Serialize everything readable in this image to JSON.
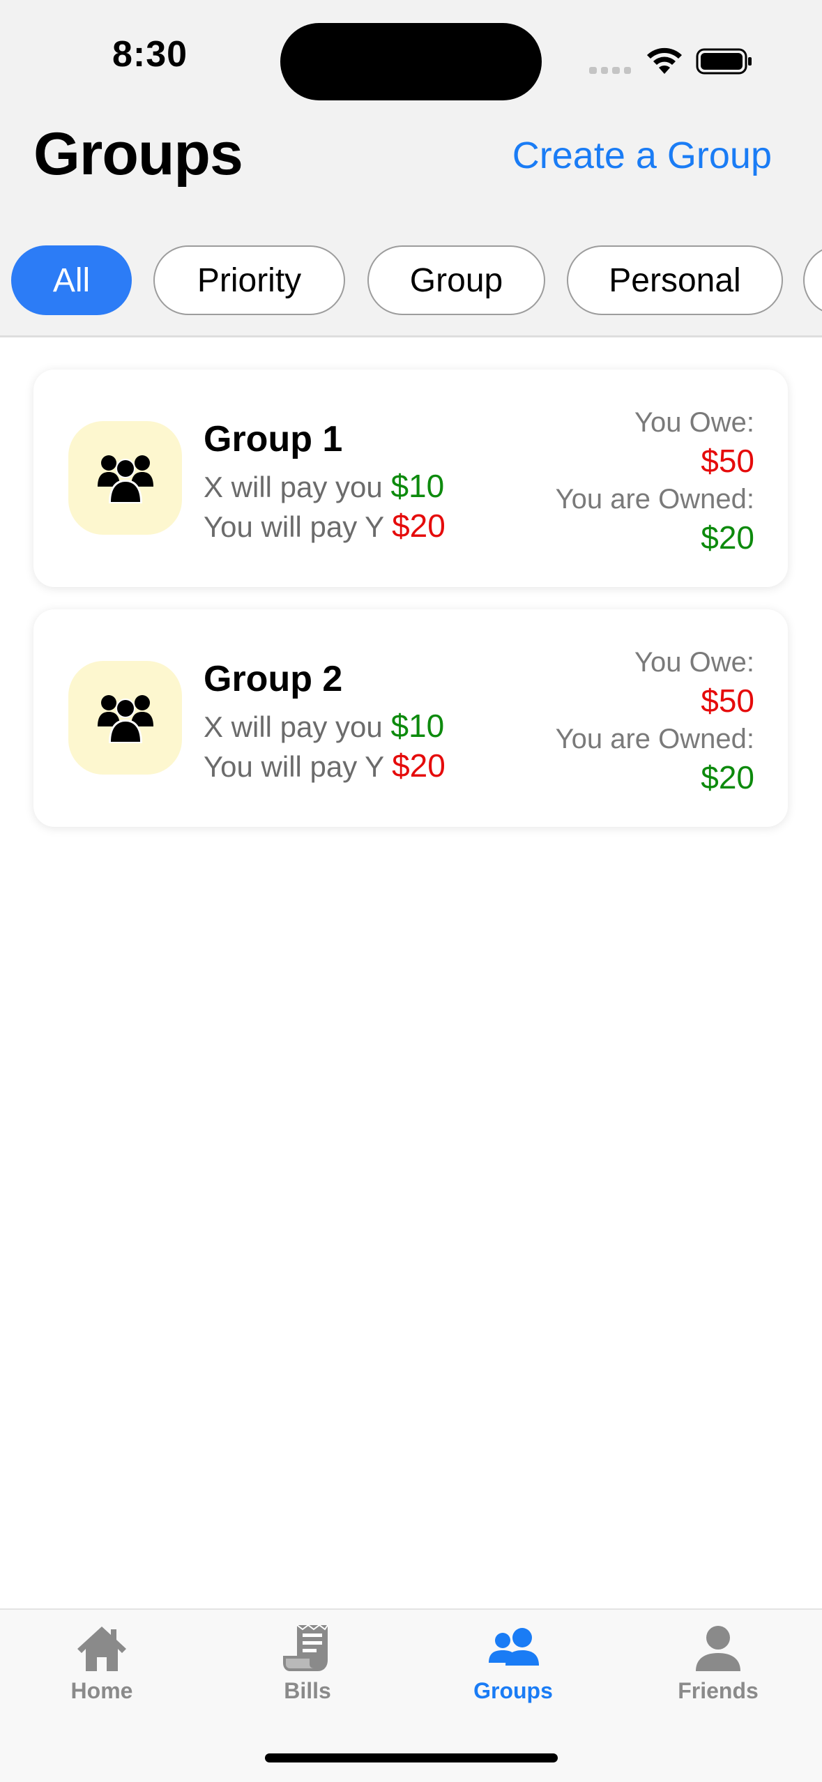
{
  "status_bar": {
    "time": "8:30"
  },
  "header": {
    "title": "Groups",
    "create_link": "Create a Group"
  },
  "filters": {
    "chips": [
      {
        "label": "All",
        "active": true
      },
      {
        "label": "Priority",
        "active": false
      },
      {
        "label": "Group",
        "active": false
      },
      {
        "label": "Personal",
        "active": false
      }
    ]
  },
  "groups": [
    {
      "name": "Group 1",
      "line1_text": "X will pay you ",
      "line1_amount": "$10",
      "line2_text": "You will pay Y ",
      "line2_amount": "$20",
      "owe_label": "You Owe:",
      "owe_value": "$50",
      "owned_label": "You are Owned:",
      "owned_value": "$20",
      "icon": "group-icon"
    },
    {
      "name": "Group 2",
      "line1_text": "X will pay you ",
      "line1_amount": "$10",
      "line2_text": "You will pay Y ",
      "line2_amount": "$20",
      "owe_label": "You Owe:",
      "owe_value": "$50",
      "owned_label": "You are Owned:",
      "owned_value": "$20",
      "icon": "group-icon"
    }
  ],
  "tabbar": {
    "tabs": [
      {
        "label": "Home",
        "icon": "home-icon",
        "active": false
      },
      {
        "label": "Bills",
        "icon": "bills-icon",
        "active": false
      },
      {
        "label": "Groups",
        "icon": "groups-icon",
        "active": true
      },
      {
        "label": "Friends",
        "icon": "friends-icon",
        "active": false
      }
    ]
  },
  "colors": {
    "accent": "#1a7cf5",
    "chip_active": "#2c7cf6",
    "positive": "#0d8a0d",
    "negative": "#e50b0b",
    "avatar_bg": "#fdf7cf"
  }
}
